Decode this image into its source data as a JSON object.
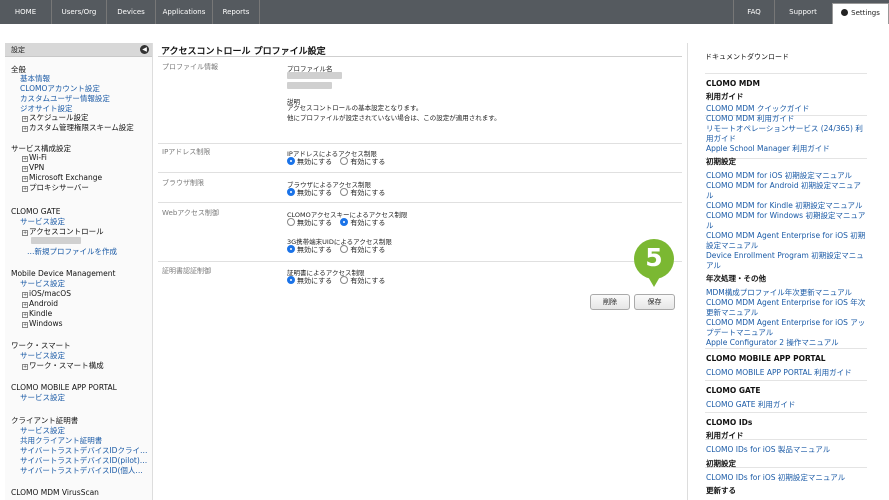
{
  "nav": {
    "left": [
      "HOME",
      "Users/Org",
      "Devices",
      "Applications",
      "Reports"
    ],
    "faq": "FAQ",
    "support": "Support",
    "settings": "Settings"
  },
  "sidebar": {
    "header": "設定",
    "collapse_icon": "◀",
    "lines": [
      {
        "type": "title",
        "text": "全般"
      },
      {
        "type": "link",
        "text": "基本情報"
      },
      {
        "type": "link",
        "text": "CLOMOアカウント設定"
      },
      {
        "type": "link",
        "text": "カスタムユーザー情報設定"
      },
      {
        "type": "link",
        "text": "ジオサイト設定"
      },
      {
        "type": "tree",
        "text": "スケジュール設定"
      },
      {
        "type": "tree",
        "text": "カスタム管理権限スキーム設定"
      },
      {
        "type": "title",
        "text": "サービス構成設定"
      },
      {
        "type": "tree",
        "text": "Wi-Fi"
      },
      {
        "type": "tree",
        "text": "VPN"
      },
      {
        "type": "tree",
        "text": "Microsoft Exchange"
      },
      {
        "type": "tree",
        "text": "プロキシサーバー"
      },
      {
        "type": "title",
        "text": "CLOMO GATE"
      },
      {
        "type": "link",
        "text": "サービス設定"
      },
      {
        "type": "tree",
        "text": "アクセスコントロール"
      },
      {
        "type": "link",
        "text": "…新規プロファイルを作成"
      },
      {
        "type": "title",
        "text": "Mobile Device Management"
      },
      {
        "type": "link",
        "text": "サービス設定"
      },
      {
        "type": "tree",
        "text": "iOS/macOS"
      },
      {
        "type": "tree",
        "text": "Android"
      },
      {
        "type": "tree",
        "text": "Kindle"
      },
      {
        "type": "tree",
        "text": "Windows"
      },
      {
        "type": "title",
        "text": "ワーク・スマート"
      },
      {
        "type": "link",
        "text": "サービス設定"
      },
      {
        "type": "tree",
        "text": "ワーク・スマート構成"
      },
      {
        "type": "title",
        "text": "CLOMO MOBILE APP PORTAL"
      },
      {
        "type": "link",
        "text": "サービス設定"
      },
      {
        "type": "title",
        "text": "クライアント証明書"
      },
      {
        "type": "link",
        "text": "サービス設定"
      },
      {
        "type": "link",
        "text": "共用クライアント証明書"
      },
      {
        "type": "link",
        "text": "サイバートラストデバイスIDクライ…"
      },
      {
        "type": "link",
        "text": "サイバートラストデバイスID(pilot)…"
      },
      {
        "type": "link",
        "text": "サイバートラストデバイスID(個人…"
      },
      {
        "type": "title",
        "text": "CLOMO MDM VirusScan"
      }
    ]
  },
  "main": {
    "title": "アクセスコントロール プロファイル設定",
    "profile_section": "プロファイル情報",
    "profile_name_label": "プロファイル名",
    "description_label": "説明",
    "description_text": [
      "アクセスコントロールの基本設定となります。",
      "他にプロファイルが設定されていない場合は、この設定が適用されます。"
    ],
    "ip_section": "IPアドレス制限",
    "ip_label": "IPアドレスによるアクセス制限",
    "browser_section": "ブラウザ制限",
    "browser_label": "ブラウザによるアクセス制限",
    "web_section": "Webアクセス制御",
    "web_label1": "CLOMOアクセスキーによるアクセス制限",
    "web_label2": "3G携帯端末UIDによるアクセス制限",
    "cert_section": "証明書認証制御",
    "cert_label": "証明書によるアクセス制限",
    "disable": "無効にする",
    "enable": "有効にする",
    "delete_button": "削除",
    "save_button": "保存",
    "step_marker": "5"
  },
  "docs": {
    "title": "ドキュメントダウンロード",
    "lines": [
      {
        "type": "h",
        "text": "CLOMO MDM"
      },
      {
        "type": "h",
        "text": "利用ガイド"
      },
      {
        "type": "l",
        "text": "CLOMO MDM クイックガイド"
      },
      {
        "type": "l",
        "text": "CLOMO MDM 利用ガイド"
      },
      {
        "type": "l",
        "text": "リモートオペレーションサービス (24/365) 利"
      },
      {
        "type": "l",
        "text": "用ガイド"
      },
      {
        "type": "l",
        "text": "Apple School Manager 利用ガイド"
      },
      {
        "type": "h",
        "text": "初期設定"
      },
      {
        "type": "l",
        "text": "CLOMO MDM for iOS 初期設定マニュアル"
      },
      {
        "type": "l",
        "text": "CLOMO MDM for Android 初期設定マニュア"
      },
      {
        "type": "l",
        "text": "ル"
      },
      {
        "type": "l",
        "text": "CLOMO MDM for Kindle 初期設定マニュアル"
      },
      {
        "type": "l",
        "text": "CLOMO MDM for Windows 初期設定マニュア"
      },
      {
        "type": "l",
        "text": "ル"
      },
      {
        "type": "l",
        "text": "CLOMO MDM Agent Enterprise for iOS 初期"
      },
      {
        "type": "l",
        "text": "設定マニュアル"
      },
      {
        "type": "l",
        "text": "Device Enrollment Program 初期設定マニュ"
      },
      {
        "type": "l",
        "text": "アル"
      },
      {
        "type": "h",
        "text": "年次処理・その他"
      },
      {
        "type": "l",
        "text": "MDM構成プロファイル年次更新マニュアル"
      },
      {
        "type": "l",
        "text": "CLOMO MDM Agent Enterprise for iOS 年次"
      },
      {
        "type": "l",
        "text": "更新マニュアル"
      },
      {
        "type": "l",
        "text": "CLOMO MDM Agent Enterprise for iOS アッ"
      },
      {
        "type": "l",
        "text": "プデートマニュアル"
      },
      {
        "type": "l",
        "text": "Apple Configurator 2 操作マニュアル"
      },
      {
        "type": "h",
        "text": "CLOMO MOBILE APP PORTAL"
      },
      {
        "type": "l",
        "text": "CLOMO MOBILE APP PORTAL 利用ガイド"
      },
      {
        "type": "h",
        "text": "CLOMO GATE"
      },
      {
        "type": "l",
        "text": "CLOMO GATE 利用ガイド"
      },
      {
        "type": "h",
        "text": "CLOMO IDs"
      },
      {
        "type": "h",
        "text": "利用ガイド"
      },
      {
        "type": "l",
        "text": "CLOMO IDs for iOS 製品マニュアル"
      },
      {
        "type": "h",
        "text": "初期設定"
      },
      {
        "type": "l",
        "text": "CLOMO IDs for iOS 初期設定マニュアル"
      },
      {
        "type": "h",
        "text": "更新する"
      }
    ]
  }
}
